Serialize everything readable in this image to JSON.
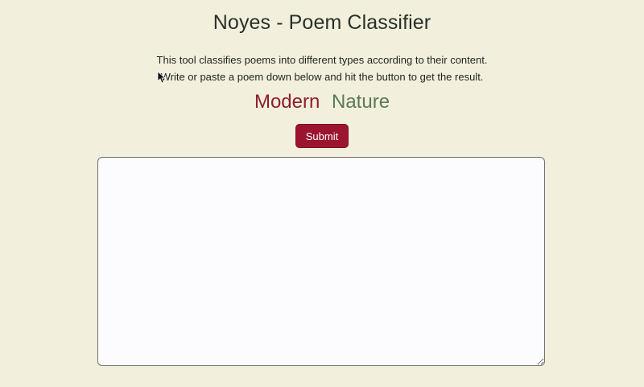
{
  "page": {
    "title": "Noyes - Poem Classifier",
    "description_line_1": "This tool classifies poems into different types according to their content.",
    "description_line_2": "Write or paste a poem down below and hit the button to get the result."
  },
  "categories": [
    {
      "label": "Modern",
      "color": "#8f1d2f"
    },
    {
      "label": "Nature",
      "color": "#5a7a55"
    }
  ],
  "form": {
    "submit_label": "Submit",
    "poem_value": "",
    "poem_placeholder": ""
  },
  "colors": {
    "background": "#f2f0dc",
    "accent": "#9b1530"
  },
  "icons": {
    "cursor": "mouse-pointer-icon"
  }
}
